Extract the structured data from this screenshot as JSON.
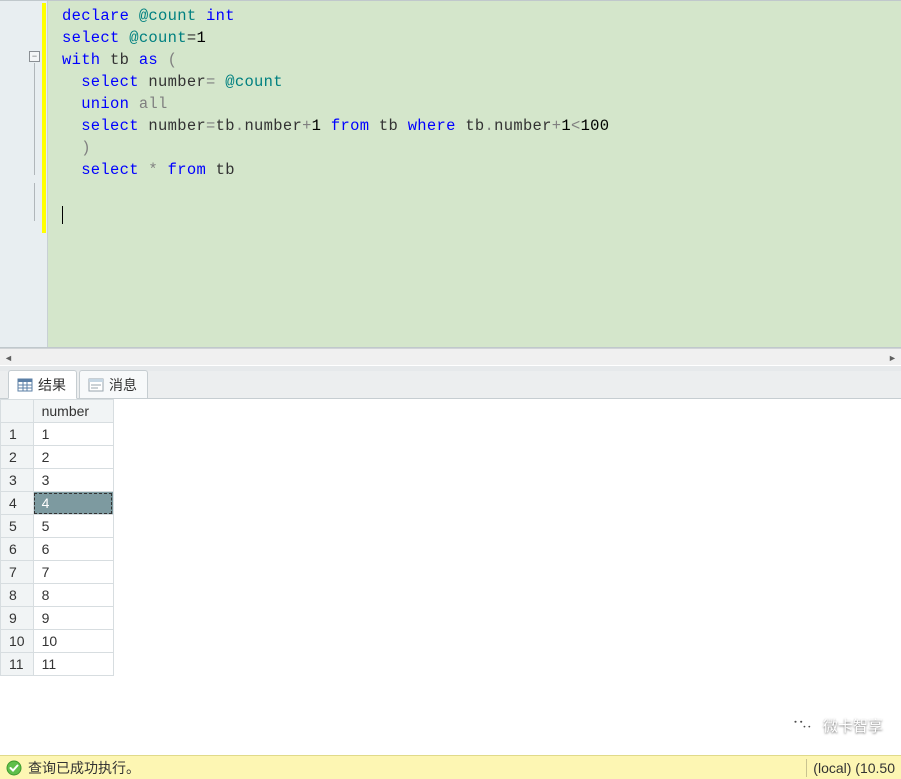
{
  "code": {
    "tokens": [
      {
        "line": 0,
        "parts": [
          {
            "t": "declare",
            "c": "kw"
          },
          {
            "t": " "
          },
          {
            "t": "@count",
            "c": "sys"
          },
          {
            "t": " "
          },
          {
            "t": "int",
            "c": "kw"
          }
        ]
      },
      {
        "line": 1,
        "parts": [
          {
            "t": "select",
            "c": "kw"
          },
          {
            "t": " "
          },
          {
            "t": "@count",
            "c": "sys"
          },
          {
            "t": "="
          },
          {
            "t": "1",
            "c": "num"
          }
        ]
      },
      {
        "line": 2,
        "parts": [
          {
            "t": "with",
            "c": "kw"
          },
          {
            "t": " tb "
          },
          {
            "t": "as",
            "c": "kw"
          },
          {
            "t": " "
          },
          {
            "t": "(",
            "c": "gray"
          }
        ]
      },
      {
        "line": 3,
        "indent": 1,
        "parts": [
          {
            "t": "select",
            "c": "kw"
          },
          {
            "t": " number"
          },
          {
            "t": "=",
            "c": "gray"
          },
          {
            "t": " "
          },
          {
            "t": "@count",
            "c": "sys"
          }
        ]
      },
      {
        "line": 4,
        "indent": 1,
        "parts": [
          {
            "t": "union",
            "c": "kw"
          },
          {
            "t": " "
          },
          {
            "t": "all",
            "c": "gray"
          }
        ]
      },
      {
        "line": 5,
        "indent": 1,
        "parts": [
          {
            "t": "select",
            "c": "kw"
          },
          {
            "t": " number"
          },
          {
            "t": "=",
            "c": "gray"
          },
          {
            "t": "tb"
          },
          {
            "t": ".",
            "c": "gray"
          },
          {
            "t": "number"
          },
          {
            "t": "+",
            "c": "gray"
          },
          {
            "t": "1",
            "c": "num"
          },
          {
            "t": " "
          },
          {
            "t": "from",
            "c": "kw"
          },
          {
            "t": " tb "
          },
          {
            "t": "where",
            "c": "kw"
          },
          {
            "t": " tb"
          },
          {
            "t": ".",
            "c": "gray"
          },
          {
            "t": "number"
          },
          {
            "t": "+",
            "c": "gray"
          },
          {
            "t": "1",
            "c": "num"
          },
          {
            "t": "<",
            "c": "gray"
          },
          {
            "t": "100",
            "c": "num"
          }
        ]
      },
      {
        "line": 6,
        "indent": 1,
        "parts": [
          {
            "t": ")",
            "c": "gray"
          }
        ]
      },
      {
        "line": 7,
        "indent": 1,
        "parts": [
          {
            "t": "select",
            "c": "kw"
          },
          {
            "t": " "
          },
          {
            "t": "*",
            "c": "star"
          },
          {
            "t": " "
          },
          {
            "t": "from",
            "c": "kw"
          },
          {
            "t": " tb"
          }
        ]
      },
      {
        "line": 8,
        "parts": []
      },
      {
        "line": 9,
        "caret": true,
        "parts": []
      }
    ]
  },
  "tabs": {
    "results": "结果",
    "messages": "消息"
  },
  "grid": {
    "header": "number",
    "rows": [
      {
        "n": "1",
        "v": "1"
      },
      {
        "n": "2",
        "v": "2"
      },
      {
        "n": "3",
        "v": "3"
      },
      {
        "n": "4",
        "v": "4",
        "selected": true
      },
      {
        "n": "5",
        "v": "5"
      },
      {
        "n": "6",
        "v": "6"
      },
      {
        "n": "7",
        "v": "7"
      },
      {
        "n": "8",
        "v": "8"
      },
      {
        "n": "9",
        "v": "9"
      },
      {
        "n": "10",
        "v": "10"
      },
      {
        "n": "11",
        "v": "11"
      }
    ]
  },
  "status": {
    "message": "查询已成功执行。",
    "connection": "(local) (10.50"
  },
  "watermark": {
    "label": "微卡智享"
  }
}
